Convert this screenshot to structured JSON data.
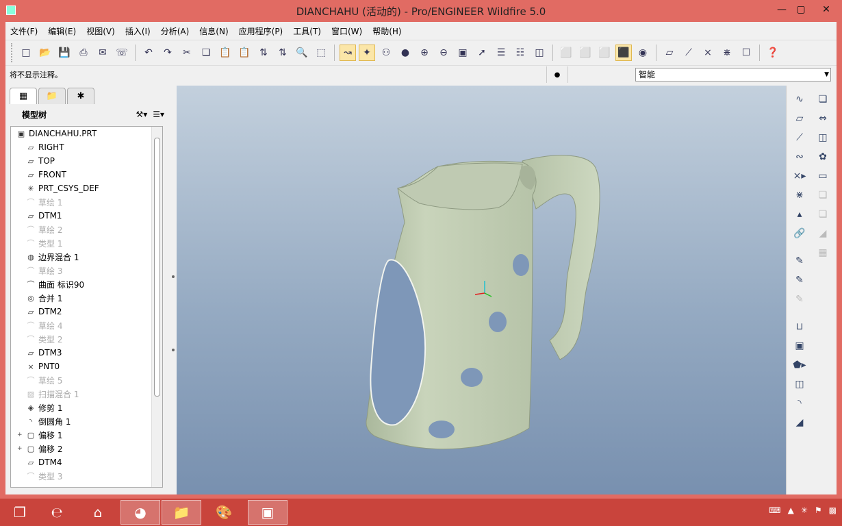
{
  "window": {
    "title": "DIANCHAHU (活动的) - Pro/ENGINEER Wildfire 5.0"
  },
  "menu": [
    "文件(F)",
    "编辑(E)",
    "视图(V)",
    "插入(I)",
    "分析(A)",
    "信息(N)",
    "应用程序(P)",
    "工具(T)",
    "窗口(W)",
    "帮助(H)"
  ],
  "status": {
    "message": "将不显示注释。",
    "filter": "智能"
  },
  "tree": {
    "title": "模型树",
    "items": [
      {
        "label": "DIANCHAHU.PRT",
        "icon": "part-icon",
        "dim": false,
        "root": true
      },
      {
        "label": "RIGHT",
        "icon": "datum-plane-icon",
        "dim": false
      },
      {
        "label": "TOP",
        "icon": "datum-plane-icon",
        "dim": false
      },
      {
        "label": "FRONT",
        "icon": "datum-plane-icon",
        "dim": false
      },
      {
        "label": "PRT_CSYS_DEF",
        "icon": "csys-icon",
        "dim": false
      },
      {
        "label": "草绘 1",
        "icon": "sketch-icon",
        "dim": true
      },
      {
        "label": "DTM1",
        "icon": "datum-plane-icon",
        "dim": false
      },
      {
        "label": "草绘 2",
        "icon": "sketch-icon",
        "dim": true
      },
      {
        "label": "类型 1",
        "icon": "type-icon",
        "dim": true
      },
      {
        "label": "边界混合 1",
        "icon": "boundary-blend-icon",
        "dim": false
      },
      {
        "label": "草绘 3",
        "icon": "sketch-icon",
        "dim": true
      },
      {
        "label": "曲面 标识90",
        "icon": "surface-icon",
        "dim": false
      },
      {
        "label": "合并 1",
        "icon": "merge-icon",
        "dim": false
      },
      {
        "label": "DTM2",
        "icon": "datum-plane-icon",
        "dim": false
      },
      {
        "label": "草绘 4",
        "icon": "sketch-icon",
        "dim": true
      },
      {
        "label": "类型 2",
        "icon": "type-icon",
        "dim": true
      },
      {
        "label": "DTM3",
        "icon": "datum-plane-icon",
        "dim": false
      },
      {
        "label": "PNT0",
        "icon": "datum-point-icon",
        "dim": false
      },
      {
        "label": "草绘 5",
        "icon": "sketch-icon",
        "dim": true
      },
      {
        "label": "扫描混合 1",
        "icon": "swept-blend-icon",
        "dim": true
      },
      {
        "label": "修剪 1",
        "icon": "trim-icon",
        "dim": false
      },
      {
        "label": "倒圆角 1",
        "icon": "round-icon",
        "dim": false
      },
      {
        "label": "偏移 1",
        "icon": "offset-icon",
        "dim": false,
        "expandable": true
      },
      {
        "label": "偏移 2",
        "icon": "offset-icon",
        "dim": false,
        "expandable": true
      },
      {
        "label": "DTM4",
        "icon": "datum-plane-icon",
        "dim": false
      },
      {
        "label": "类型 3",
        "icon": "type-icon",
        "dim": true
      }
    ]
  },
  "colors": {
    "model": "#c4cfb6",
    "inside": "#7e97b8",
    "background_top": "#c3d0dd",
    "background_bottom": "#7890af"
  }
}
